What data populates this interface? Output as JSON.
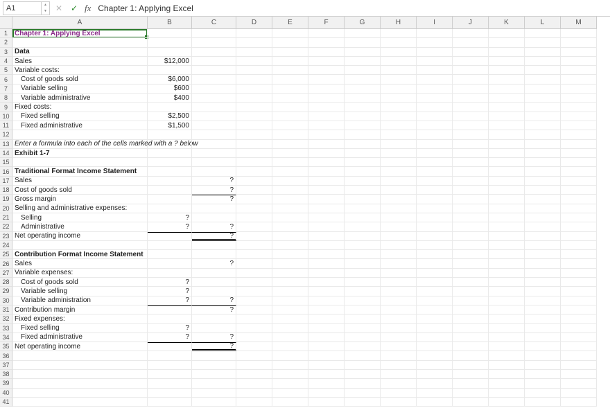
{
  "formula_bar": {
    "name_box": "A1",
    "fx_label": "fx",
    "content": "Chapter 1: Applying Excel"
  },
  "columns": [
    "A",
    "B",
    "C",
    "D",
    "E",
    "F",
    "G",
    "H",
    "I",
    "J",
    "K",
    "L",
    "M"
  ],
  "rows": [
    {
      "n": 1,
      "A": "Chapter 1: Applying Excel",
      "A_style": "purple"
    },
    {
      "n": 2
    },
    {
      "n": 3,
      "A": "Data",
      "A_style": "bold"
    },
    {
      "n": 4,
      "A": "Sales",
      "B": "$12,000"
    },
    {
      "n": 5,
      "A": "Variable costs:"
    },
    {
      "n": 6,
      "A": "Cost of goods sold",
      "A_style": "indent1",
      "B": "$6,000"
    },
    {
      "n": 7,
      "A": "Variable selling",
      "A_style": "indent1",
      "B": "$600"
    },
    {
      "n": 8,
      "A": "Variable administrative",
      "A_style": "indent1",
      "B": "$400"
    },
    {
      "n": 9,
      "A": "Fixed costs:"
    },
    {
      "n": 10,
      "A": "Fixed selling",
      "A_style": "indent1",
      "B": "$2,500"
    },
    {
      "n": 11,
      "A": "Fixed administrative",
      "A_style": "indent1",
      "B": "$1,500"
    },
    {
      "n": 12
    },
    {
      "n": 13,
      "A": "Enter a formula into each of the cells marked with a ? below",
      "A_style": "italic"
    },
    {
      "n": 14,
      "A": "Exhibit 1-7",
      "A_style": "bold"
    },
    {
      "n": 15
    },
    {
      "n": 16,
      "A": "Traditional Format Income Statement",
      "A_style": "bold"
    },
    {
      "n": 17,
      "A": "Sales",
      "C": "?"
    },
    {
      "n": 18,
      "A": "Cost of goods sold",
      "C": "?"
    },
    {
      "n": 19,
      "A": "Gross margin",
      "C": "?",
      "C_style": "bt-single"
    },
    {
      "n": 20,
      "A": "Selling and administrative expenses:"
    },
    {
      "n": 21,
      "A": "Selling",
      "A_style": "indent1",
      "B": "?"
    },
    {
      "n": 22,
      "A": "Administrative",
      "A_style": "indent1",
      "B": "?",
      "C": "?"
    },
    {
      "n": 23,
      "A": "Net operating income",
      "B_style": "bt-single",
      "C": "?",
      "C_style": "bt-single bb-double"
    },
    {
      "n": 24
    },
    {
      "n": 25,
      "A": "Contribution Format Income Statement",
      "A_style": "bold"
    },
    {
      "n": 26,
      "A": "Sales",
      "C": "?"
    },
    {
      "n": 27,
      "A": "Variable expenses:"
    },
    {
      "n": 28,
      "A": "Cost of goods sold",
      "A_style": "indent1",
      "B": "?"
    },
    {
      "n": 29,
      "A": "Variable selling",
      "A_style": "indent1",
      "B": "?"
    },
    {
      "n": 30,
      "A": "Variable administration",
      "A_style": "indent1",
      "B": "?",
      "C": "?"
    },
    {
      "n": 31,
      "A": "Contribution margin",
      "B_style": "bt-single",
      "C": "?",
      "C_style": "bt-single"
    },
    {
      "n": 32,
      "A": "Fixed expenses:"
    },
    {
      "n": 33,
      "A": "Fixed selling",
      "A_style": "indent1",
      "B": "?"
    },
    {
      "n": 34,
      "A": "Fixed administrative",
      "A_style": "indent1",
      "B": "?",
      "C": "?"
    },
    {
      "n": 35,
      "A": "Net operating income",
      "B_style": "bt-single",
      "C": "?",
      "C_style": "bt-single bb-double"
    },
    {
      "n": 36
    },
    {
      "n": 37
    },
    {
      "n": 38
    },
    {
      "n": 39
    },
    {
      "n": 40
    },
    {
      "n": 41
    }
  ]
}
